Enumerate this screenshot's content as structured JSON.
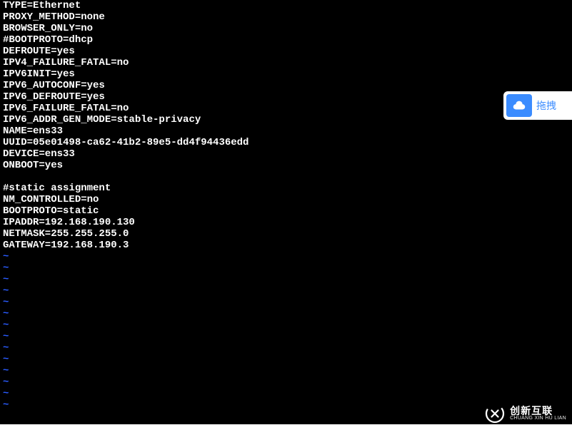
{
  "config_lines": [
    "TYPE=Ethernet",
    "PROXY_METHOD=none",
    "BROWSER_ONLY=no",
    "#BOOTPROTO=dhcp",
    "DEFROUTE=yes",
    "IPV4_FAILURE_FATAL=no",
    "IPV6INIT=yes",
    "IPV6_AUTOCONF=yes",
    "IPV6_DEFROUTE=yes",
    "IPV6_FAILURE_FATAL=no",
    "IPV6_ADDR_GEN_MODE=stable-privacy",
    "NAME=ens33",
    "UUID=05e01498-ca62-41b2-89e5-dd4f94436edd",
    "DEVICE=ens33",
    "ONBOOT=yes",
    "",
    "#static assignment",
    "NM_CONTROLLED=no",
    "BOOTPROTO=static",
    "IPADDR=192.168.190.130",
    "NETMASK=255.255.255.0",
    "GATEWAY=192.168.190.3"
  ],
  "tilde_count": 14,
  "tilde_char": "~",
  "float_button": {
    "icon_name": "cloud-icon",
    "label": "拖拽"
  },
  "watermark": {
    "main": "创新互联",
    "sub": "CHUANG XIN HU LIAN"
  }
}
